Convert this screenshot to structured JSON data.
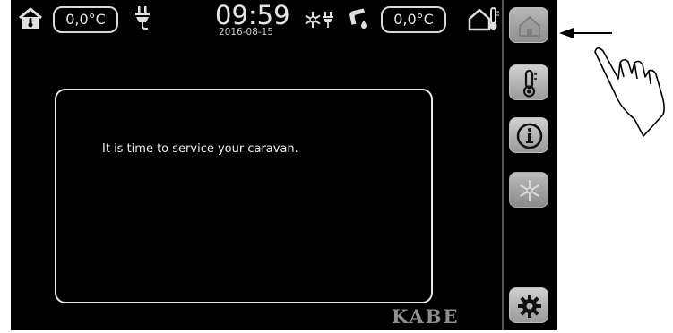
{
  "status_bar": {
    "indoor_temperature": "0,0°C",
    "outdoor_temperature": "0,0°C",
    "time": "09:59",
    "date": "2016-08-15"
  },
  "message": {
    "text": "It is time to service your caravan."
  },
  "brand": {
    "logo_text": "KABE"
  },
  "sidebar": {
    "buttons": [
      "home",
      "temperature",
      "info",
      "frost-protection",
      "settings"
    ]
  },
  "colors": {
    "screen_background": "#000000",
    "button_gray": "#b0b0b0",
    "text_light": "#e6e6e6"
  }
}
